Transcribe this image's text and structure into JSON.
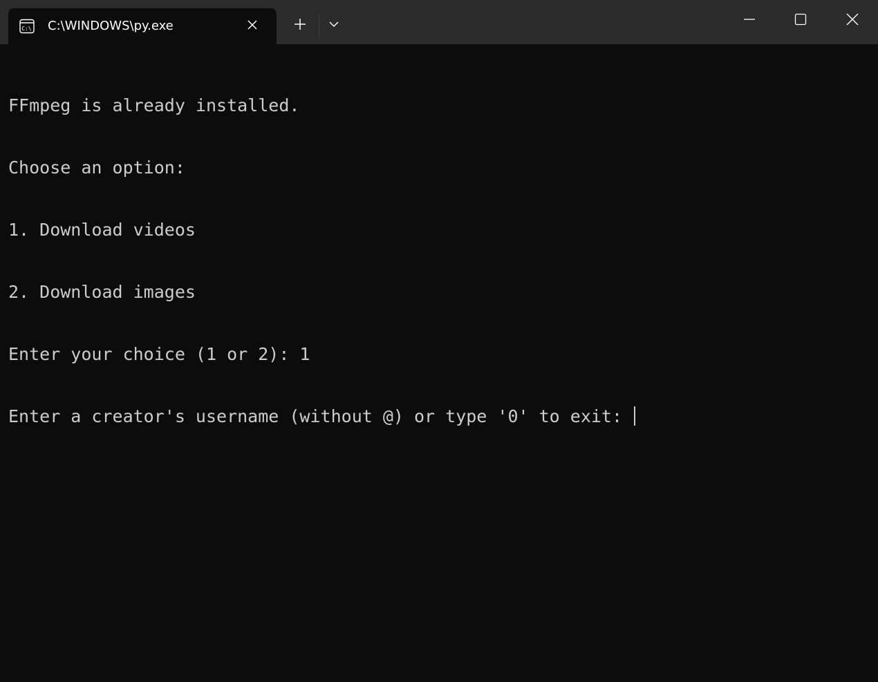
{
  "window": {
    "tab_title": "C:\\WINDOWS\\py.exe",
    "tab_icon": "terminal-icon",
    "icons": {
      "close_tab": "close-icon",
      "new_tab": "plus-icon",
      "dropdown": "chevron-down-icon",
      "minimize": "minimize-icon",
      "maximize": "maximize-icon",
      "close_window": "close-icon"
    }
  },
  "terminal": {
    "lines": [
      "FFmpeg is already installed.",
      "Choose an option:",
      "1. Download videos",
      "2. Download images",
      "Enter your choice (1 or 2): 1",
      "Enter a creator's username (without @) or type '0' to exit: "
    ],
    "input_value": ""
  },
  "colors": {
    "titlebar_bg": "#2b2b2b",
    "terminal_bg": "#0c0c0c",
    "terminal_fg": "#cccccc",
    "tab_title_fg": "#ffffff"
  }
}
